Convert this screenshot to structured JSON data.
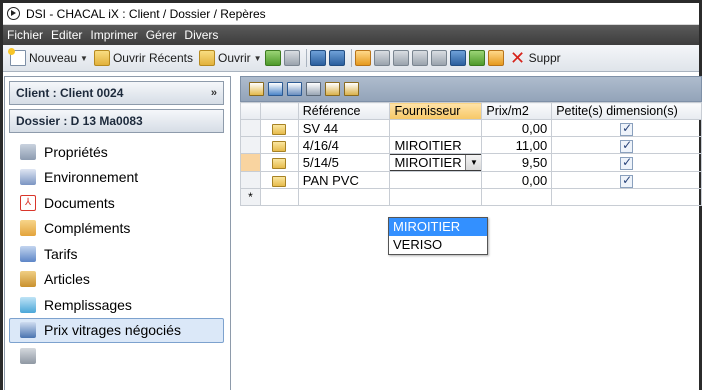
{
  "window": {
    "title": "DSI - CHACAL iX : Client / Dossier / Repères"
  },
  "menu": [
    "Fichier",
    "Editer",
    "Imprimer",
    "Gérer",
    "Divers"
  ],
  "toolbar": {
    "new_label": "Nouveau",
    "recent_label": "Ouvrir Récents",
    "open_label": "Ouvrir",
    "delete_label": "Suppr"
  },
  "sidebar": {
    "client_header": "Client : Client 0024",
    "dossier_header": "Dossier : D 13 Ma0083",
    "items": [
      {
        "label": "Propriétés",
        "icon": "properties-icon",
        "color": "#8c9bb0"
      },
      {
        "label": "Environnement",
        "icon": "environment-icon",
        "color": "#7b95c2"
      },
      {
        "label": "Documents",
        "icon": "pdf-icon",
        "color": "#d9362b"
      },
      {
        "label": "Compléments",
        "icon": "complements-icon",
        "color": "#e3a33c"
      },
      {
        "label": "Tarifs",
        "icon": "tarifs-icon",
        "color": "#5d86c7"
      },
      {
        "label": "Articles",
        "icon": "articles-icon",
        "color": "#c9912e"
      },
      {
        "label": "Remplissages",
        "icon": "remplissages-icon",
        "color": "#4aa6d8"
      },
      {
        "label": "Prix vitrages négociés",
        "icon": "prix-vitrages-icon",
        "color": "#4a74b0",
        "selected": true
      }
    ]
  },
  "grid": {
    "columns": [
      "Référence",
      "Fournisseur",
      "Prix/m2",
      "Petite(s) dimension(s)"
    ],
    "rows": [
      {
        "reference": "SV 44",
        "fournisseur": "",
        "prix": "0,00",
        "petite": true
      },
      {
        "reference": "4/16/4",
        "fournisseur": "MIROITIER",
        "prix": "11,00",
        "petite": true
      },
      {
        "reference": "5/14/5",
        "fournisseur": "MIROITIER",
        "prix": "9,50",
        "petite": true,
        "editing": true
      },
      {
        "reference": "PAN PVC",
        "fournisseur": "",
        "prix": "0,00",
        "petite": true
      }
    ],
    "new_row_marker": "*",
    "dropdown_options": [
      "MIROITIER",
      "VERISO"
    ],
    "dropdown_selected": "MIROITIER"
  }
}
